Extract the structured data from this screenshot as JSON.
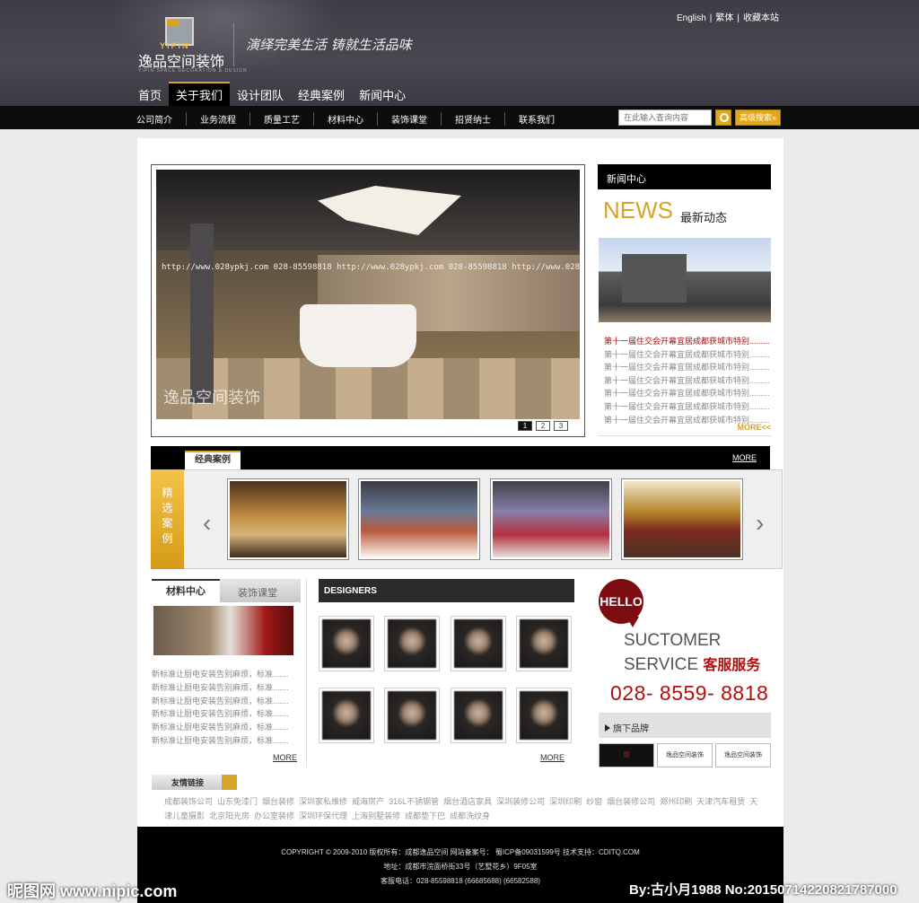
{
  "header": {
    "logo_en": "YIPIN",
    "logo_cn": "逸品空间装饰",
    "logo_sub": "YIPIN SPACE DECORATION & DESIGN",
    "slogan": "演绎完美生活   铸就生活品味",
    "top_links": [
      "English",
      "繁体",
      "收藏本站"
    ]
  },
  "main_nav": [
    "首页",
    "关于我们",
    "设计团队",
    "经典案例",
    "新闻中心"
  ],
  "sub_nav": [
    "公司简介",
    "业务流程",
    "质量工艺",
    "材料中心",
    "装饰课堂",
    "招贤纳士",
    "联系我们"
  ],
  "search": {
    "placeholder": "在此输入查询内容",
    "advanced": "高级搜索»"
  },
  "slider": {
    "watermark": "http://www.028ypkj.com  028-85598818  http://www.028ypkj.com  028-85598818  http://www.028ypkj.com",
    "brand_watermark": "逸品空间装饰",
    "pages": [
      "1",
      "2",
      "3"
    ]
  },
  "news": {
    "title": "新闻中心",
    "big": "NEWS",
    "big_cn": "最新动态",
    "items": [
      "第十一届住交会开幕宜居成都获城市特别.........",
      "第十一届住交会开幕宜居成都获城市特别.........",
      "第十一届住交会开幕宜居成都获城市特别.........",
      "第十一届住交会开幕宜居成都获城市特别.........",
      "第十一届住交会开幕宜居成都获城市特别.........",
      "第十一届住交会开幕宜居成都获城市特别.........",
      "第十一届住交会开幕宜居成都获城市特别........."
    ],
    "more": "MORE<<"
  },
  "cases": {
    "tab": "经典案例",
    "more": "MORE",
    "label_chars": [
      "精",
      "选",
      "案",
      "例"
    ],
    "prev": "‹",
    "next": "›"
  },
  "materials": {
    "tab1": "材料中心",
    "tab2": "装饰课堂",
    "items": [
      "新标准让厨电安装告别麻烦，标准.......",
      "新标准让厨电安装告别麻烦，标准.......",
      "新标准让厨电安装告别麻烦，标准.......",
      "新标准让厨电安装告别麻烦，标准.......",
      "新标准让厨电安装告别麻烦，标准.......",
      "新标准让厨电安装告别麻烦，标准......."
    ],
    "more": "MORE"
  },
  "designers": {
    "title": "DESIGNERS",
    "more": "MORE"
  },
  "service": {
    "hello": "HELLO",
    "line1": "SUCTOMER",
    "line2": "SERVICE",
    "line2_cn": "客服服务",
    "phone": "028- 8559- 8818",
    "brands_title": "旗下品牌",
    "brands": [
      "凰",
      "逸品空间装饰",
      "逸品空间装饰"
    ]
  },
  "friends": {
    "title": "友情链接",
    "links": [
      "成都装饰公司",
      "山东免漆门",
      "烟台装修",
      "深圳家私维修",
      "威海房产",
      "316L不锈钢管",
      "烟台酒店家具",
      "深圳装修公司",
      "深圳印刷",
      "纱窗",
      "烟台装修公司",
      "郑州印刷",
      "天津汽车租赁",
      "天津儿童摄影",
      "北京阳光房",
      "办公室装修",
      "深圳环保代理",
      "上海别墅装修",
      "成都垫下巴",
      "成都洗纹身"
    ]
  },
  "footer": {
    "line1": "COPYRIGHT © 2009-2010 版权所有：成都逸品空间  网站备案号： 蜀ICP备09031599号  技术支持：CDITQ.COM",
    "line2": "地址：成都市浣面桥街33号（艺墅花乡）9F05室",
    "line3": "客服电话：028-85598818 (66685688) (66582588)"
  },
  "watermarks": {
    "left": "昵图网 www.nipic.com",
    "right": "By:古小月1988 No:20150714220821787000"
  },
  "colors": {
    "accent": "#d8a428",
    "dark": "#000000",
    "red": "#b01010"
  }
}
